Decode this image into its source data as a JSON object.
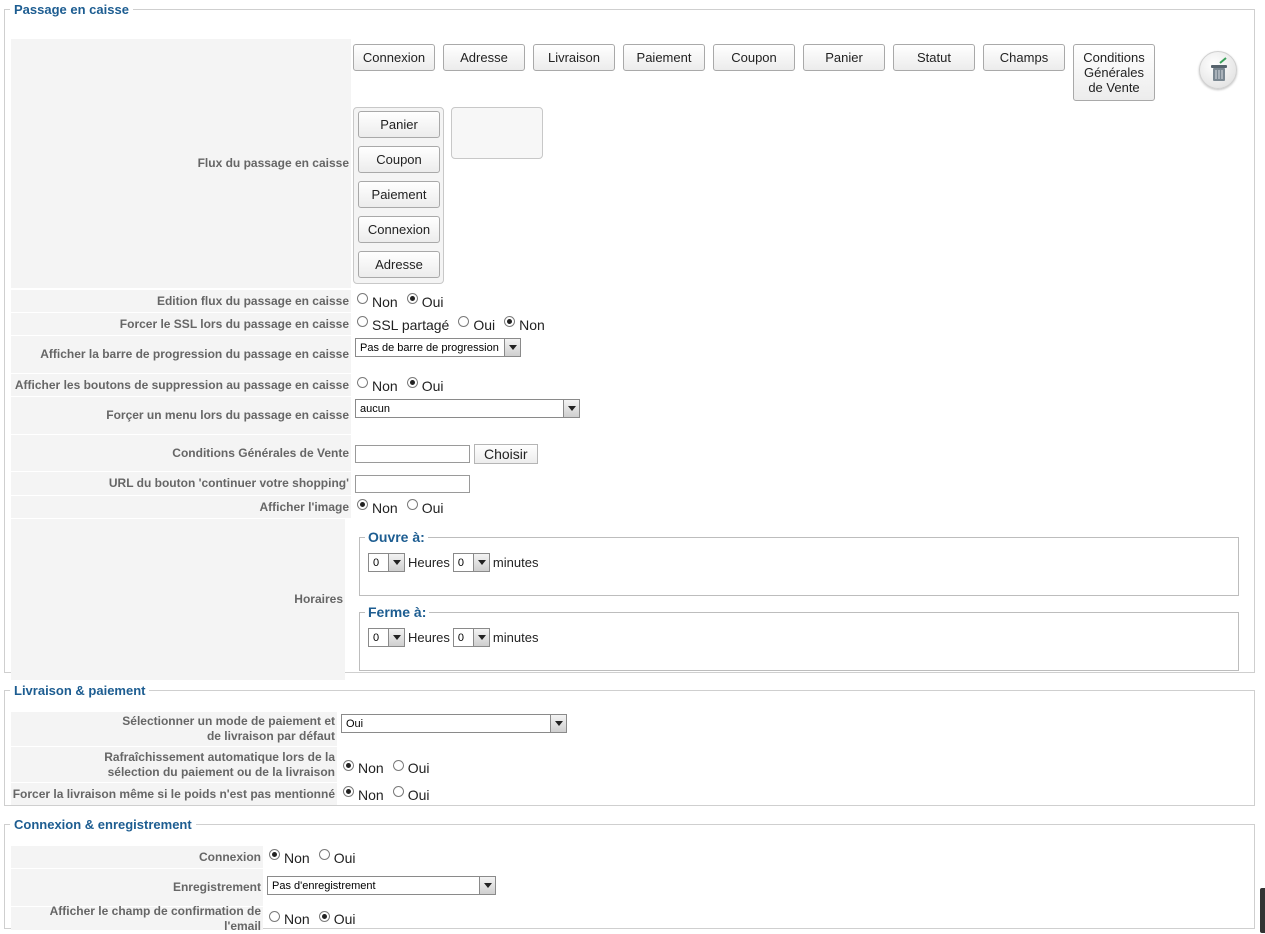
{
  "checkout": {
    "legend": "Passage en caisse",
    "steps": [
      "Connexion",
      "Adresse",
      "Livraison",
      "Paiement",
      "Coupon",
      "Panier",
      "Statut",
      "Champs",
      "Conditions Générales de Vente"
    ],
    "flow_items": [
      "Panier",
      "Coupon",
      "Paiement",
      "Connexion",
      "Adresse"
    ],
    "labels": {
      "flow": "Flux du passage en caisse",
      "edit_flow": "Edition flux du passage en caisse",
      "force_ssl": "Forcer le SSL lors du passage en caisse",
      "progress_bar": "Afficher la barre de progression du passage en caisse",
      "delete_buttons": "Afficher les boutons de suppression au passage en caisse",
      "force_menu": "Forçer un menu lors du passage en caisse",
      "terms": "Conditions Générales de Vente",
      "continue_url": "URL du bouton 'continuer votre shopping'",
      "show_image": "Afficher l'image",
      "hours": "Horaires"
    },
    "opt_non": "Non",
    "opt_oui": "Oui",
    "opt_ssl_shared": "SSL partagé",
    "progress_bar_value": "Pas de barre de progression",
    "force_menu_value": "aucun",
    "choose_button": "Choisir",
    "opens_legend": "Ouvre à:",
    "closes_legend": "Ferme à:",
    "hours_value": "0",
    "minutes_value": "0",
    "hours_word": "Heures",
    "minutes_word": "minutes",
    "state": {
      "edit_flow": "Oui",
      "force_ssl": "Non",
      "delete_buttons": "Oui",
      "show_image": "Non"
    }
  },
  "shipping": {
    "legend": "Livraison & paiement",
    "labels": {
      "default_mode": "Sélectionner un mode de paiement et de livraison par défaut",
      "auto_refresh": "Rafraîchissement automatique lors de la sélection du paiement ou de la livraison",
      "force_shipping": "Forcer la livraison même si le poids n'est pas mentionné"
    },
    "default_mode_value": "Oui",
    "opt_non": "Non",
    "opt_oui": "Oui",
    "state": {
      "auto_refresh": "Non",
      "force_shipping": "Non"
    }
  },
  "login": {
    "legend": "Connexion & enregistrement",
    "labels": {
      "login": "Connexion",
      "registration": "Enregistrement",
      "email_confirm": "Afficher le champ de confirmation de l'email"
    },
    "registration_value": "Pas d'enregistrement",
    "opt_non": "Non",
    "opt_oui": "Oui",
    "state": {
      "login": "Non",
      "email_confirm": "Oui"
    }
  }
}
